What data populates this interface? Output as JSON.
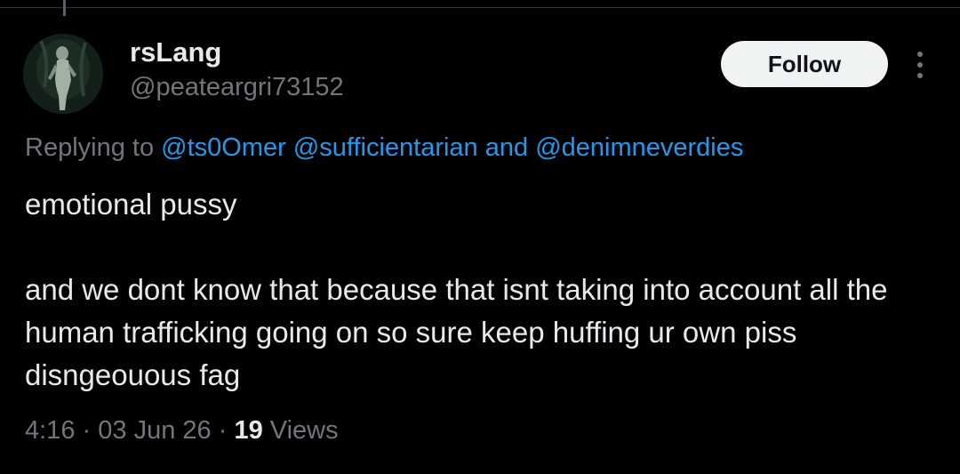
{
  "user": {
    "display_name": "rsLang",
    "handle": "@peateargri73152"
  },
  "follow_label": "Follow",
  "reply": {
    "prefix": "Replying to",
    "mentions": [
      "@ts0Omer",
      "@sufficientarian",
      "@denimneverdies"
    ],
    "conjunction": "and"
  },
  "tweet": {
    "paragraphs": [
      "emotional pussy",
      "and we dont know that because that isnt taking into account all the human trafficking going on so sure keep huffing ur own piss disngeouous fag"
    ]
  },
  "meta": {
    "time": "4:16",
    "date": "03 Jun 26",
    "separator": "·",
    "views_count": "19",
    "views_label": "Views"
  },
  "colors": {
    "background": "#000000",
    "text_primary": "#e7e9ea",
    "text_secondary": "#71767b",
    "link": "#1d9bf0",
    "button_bg": "#eff3f4"
  },
  "icons": {
    "more": "more-vertical-icon"
  }
}
